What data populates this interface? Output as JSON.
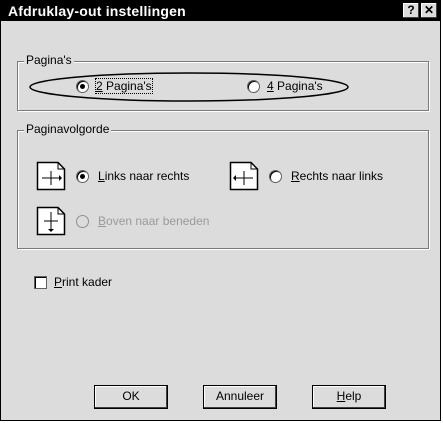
{
  "window": {
    "title": "Afdruklay-out instellingen",
    "help_glyph": "?",
    "close_glyph": "✕"
  },
  "pages_group": {
    "legend": "Pagina's",
    "options": [
      {
        "label_first": "2",
        "label_rest": " Pagina's",
        "checked": true
      },
      {
        "label_first": "4",
        "label_rest": " Pagina's",
        "checked": false
      }
    ]
  },
  "order_group": {
    "legend": "Paginavolgorde",
    "options": [
      {
        "icon": "left-to-right-icon",
        "label_first": "L",
        "label_rest": "inks naar rechts",
        "checked": true,
        "enabled": true
      },
      {
        "icon": "right-to-left-icon",
        "label_first": "R",
        "label_rest": "echts naar links",
        "checked": false,
        "enabled": true
      },
      {
        "icon": "top-to-bottom-icon",
        "label_first": "B",
        "label_rest": "oven naar beneden",
        "checked": false,
        "enabled": false
      }
    ]
  },
  "print_border": {
    "label_first": "P",
    "label_rest": "rint kader",
    "checked": false
  },
  "buttons": {
    "ok": "OK",
    "cancel": "Annuleer",
    "help_first": "H",
    "help_rest": "elp"
  }
}
